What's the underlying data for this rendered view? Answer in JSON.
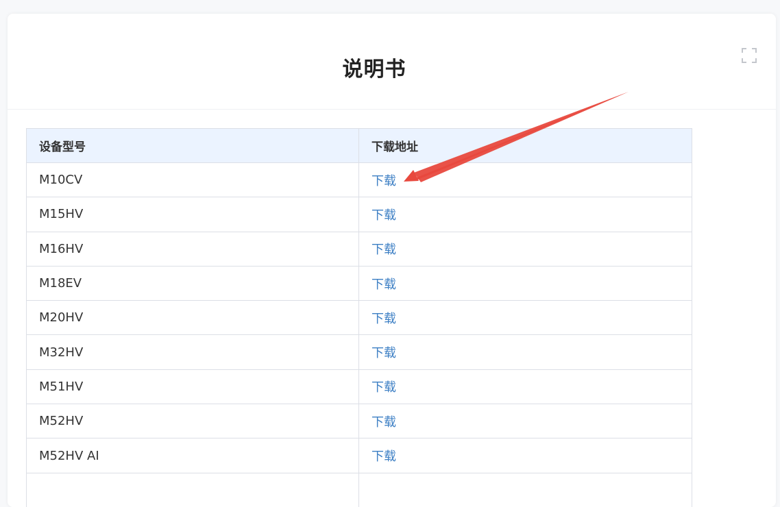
{
  "title": "说明书",
  "table": {
    "headers": {
      "model": "设备型号",
      "download": "下载地址"
    },
    "rows": [
      {
        "model": "M10CV",
        "link": "下载"
      },
      {
        "model": "M15HV",
        "link": "下载"
      },
      {
        "model": "M16HV",
        "link": "下载"
      },
      {
        "model": "M18EV",
        "link": "下载"
      },
      {
        "model": "M20HV",
        "link": "下载"
      },
      {
        "model": "M32HV",
        "link": "下载"
      },
      {
        "model": "M51HV",
        "link": "下载"
      },
      {
        "model": "M52HV",
        "link": "下载"
      },
      {
        "model": "M52HV AI",
        "link": "下载"
      },
      {
        "model": "",
        "link": ""
      }
    ]
  },
  "colors": {
    "header_bg": "#ebf3ff",
    "link": "#3d7fc4",
    "annotation_arrow": "#e8493e"
  },
  "icons": {
    "fullscreen": "fullscreen-expand-icon",
    "annotation": "red-arrow-annotation"
  }
}
